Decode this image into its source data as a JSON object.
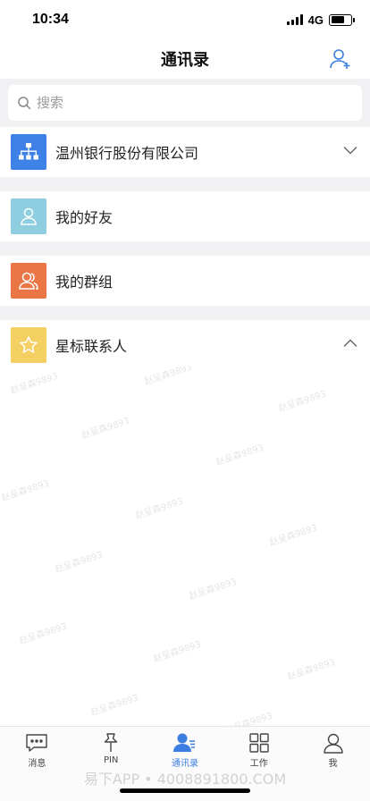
{
  "status": {
    "time": "10:34",
    "network": "4G",
    "battery_level": 0.7
  },
  "header": {
    "title": "通讯录"
  },
  "search": {
    "placeholder": "搜索"
  },
  "rows": [
    {
      "label": "温州银行股份有限公司",
      "icon": "org-chart-icon",
      "color": "#3e82e8",
      "expander": "chevron-down"
    },
    {
      "label": "我的好友",
      "icon": "user-icon",
      "color": "#8fcde0"
    },
    {
      "label": "我的群组",
      "icon": "group-icon",
      "color": "#ea7545"
    },
    {
      "label": "星标联系人",
      "icon": "star-icon",
      "color": "#f4cf61",
      "expander": "chevron-up"
    }
  ],
  "watermark": "赵呈森9893",
  "footer_watermark": "易下APP • 4008891800.COM",
  "tabs": [
    {
      "label": "消息",
      "icon": "message-icon",
      "active": false
    },
    {
      "label": "PIN",
      "icon": "pin-icon",
      "active": false
    },
    {
      "label": "通讯录",
      "icon": "contacts-icon",
      "active": true
    },
    {
      "label": "工作",
      "icon": "grid-icon",
      "active": false
    },
    {
      "label": "我",
      "icon": "profile-icon",
      "active": false
    }
  ],
  "colors": {
    "accent": "#3b7de0",
    "background": "#f1f1f3"
  }
}
